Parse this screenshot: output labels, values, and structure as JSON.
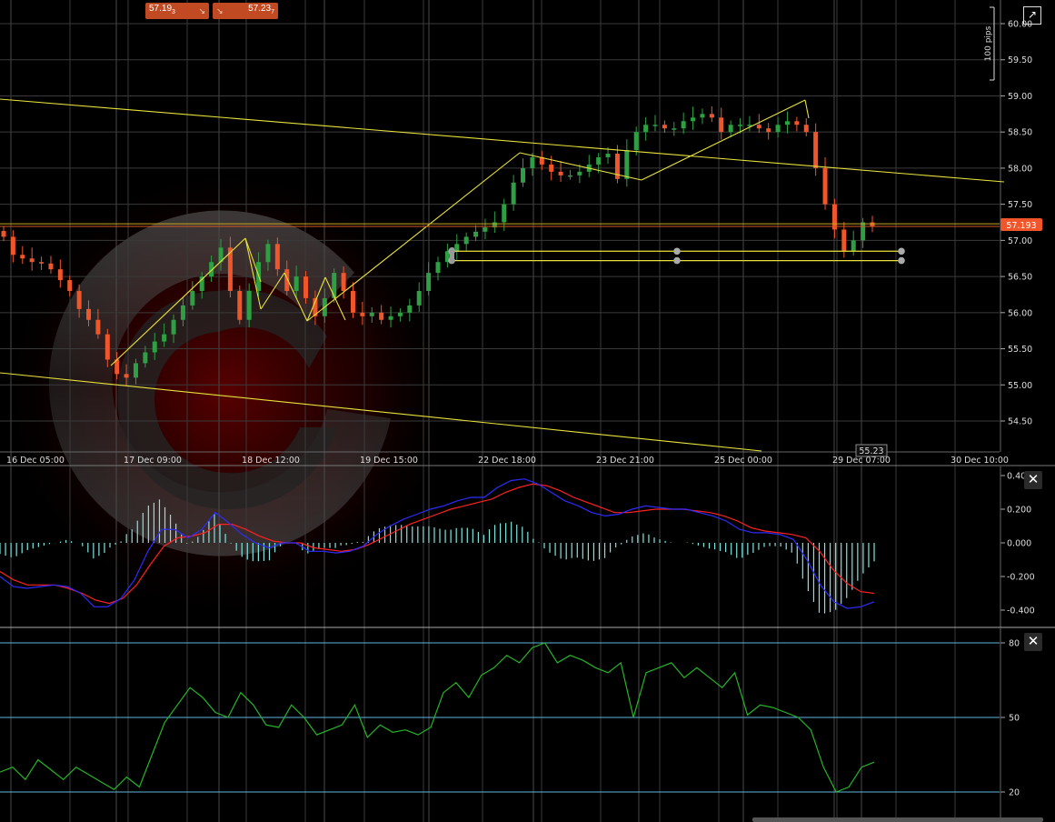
{
  "toolbar": {
    "sell_price": "57.19",
    "sell_price_sup": "3",
    "buy_price": "57.23",
    "buy_price_sup": "7",
    "sell_icon": "arrow-down-right-icon",
    "buy_icon": "arrow-down-right-icon",
    "expand_icon": "expand-icon"
  },
  "colors": {
    "background": "#000000",
    "grid": "#3a3a3a",
    "candle_up": "#2ea043",
    "candle_down": "#f0562a",
    "trendline": "#e8e23a",
    "price_marker": "#f0562a",
    "macd_line": "#2c2cff",
    "signal_line": "#ff2020",
    "histogram": "#7fe6e0",
    "rsi_line": "#25b525",
    "rsi_levels": "#5fb4dc"
  },
  "price_panel": {
    "scale_label": "100 pips",
    "current_price": "57.193",
    "cursor_price": "55.23",
    "y_ticks": [
      "60.00",
      "59.50",
      "59.00",
      "58.50",
      "58.00",
      "57.50",
      "57.00",
      "56.50",
      "56.00",
      "55.50",
      "55.00",
      "54.50"
    ],
    "x_ticks": [
      "16 Dec 05:00",
      "17 Dec 09:00",
      "18 Dec 12:00",
      "19 Dec 15:00",
      "22 Dec 18:00",
      "23 Dec 21:00",
      "25 Dec 00:00",
      "29 Dec 07:00",
      "30 Dec 10:00"
    ]
  },
  "macd_panel": {
    "y_ticks": [
      "0.400",
      "0.200",
      "0.000",
      "-0.200",
      "-0.400"
    ]
  },
  "rsi_panel": {
    "y_ticks": [
      "80",
      "50",
      "20"
    ]
  },
  "chart_data": [
    {
      "type": "candlestick",
      "ylim": [
        54.1,
        60.2
      ],
      "x_ticks": [
        "16 Dec 05:00",
        "17 Dec 09:00",
        "18 Dec 12:00",
        "19 Dec 15:00",
        "22 Dec 18:00",
        "23 Dec 21:00",
        "25 Dec 00:00",
        "29 Dec 07:00",
        "30 Dec 10:00"
      ],
      "closes": [
        57.05,
        56.8,
        56.75,
        56.7,
        56.68,
        56.6,
        56.45,
        56.3,
        56.05,
        55.9,
        55.7,
        55.35,
        55.15,
        55.1,
        55.3,
        55.45,
        55.6,
        55.7,
        55.9,
        56.1,
        56.3,
        56.5,
        56.7,
        56.9,
        56.3,
        55.9,
        56.3,
        56.7,
        56.95,
        56.6,
        56.3,
        56.5,
        56.2,
        55.95,
        56.2,
        56.55,
        56.3,
        56.0,
        55.95,
        56.0,
        55.9,
        55.95,
        56.0,
        56.1,
        56.3,
        56.55,
        56.7,
        56.85,
        56.95,
        57.05,
        57.12,
        57.18,
        57.25,
        57.5,
        57.8,
        58.0,
        58.15,
        58.05,
        57.95,
        57.9,
        57.9,
        57.95,
        58.05,
        58.15,
        58.2,
        57.85,
        58.25,
        58.5,
        58.6,
        58.6,
        58.55,
        58.55,
        58.65,
        58.7,
        58.75,
        58.7,
        58.5,
        58.6,
        58.6,
        58.6,
        58.55,
        58.5,
        58.6,
        58.65,
        58.6,
        58.5,
        58.0,
        57.5,
        57.15,
        56.85,
        57.0,
        57.25,
        57.19
      ],
      "current": 57.193,
      "horizontal_levels": [
        57.23,
        56.85,
        56.72
      ]
    },
    {
      "type": "line",
      "ylim": [
        -0.45,
        0.4
      ],
      "series": [
        {
          "values": [
            -0.2,
            -0.26,
            -0.27,
            -0.26,
            -0.25,
            -0.26,
            -0.3,
            -0.38,
            -0.38,
            -0.33,
            -0.22,
            -0.05,
            0.08,
            0.08,
            0.03,
            0.08,
            0.18,
            0.12,
            0.05,
            0.0,
            -0.03,
            0.0,
            0.0,
            -0.05,
            -0.05,
            -0.06,
            -0.05,
            -0.02,
            0.05,
            0.1,
            0.14,
            0.17,
            0.2,
            0.22,
            0.25,
            0.27,
            0.27,
            0.33,
            0.37,
            0.38,
            0.35,
            0.3,
            0.25,
            0.22,
            0.18,
            0.16,
            0.17,
            0.2,
            0.22,
            0.21,
            0.2,
            0.2,
            0.18,
            0.16,
            0.13,
            0.08,
            0.06,
            0.06,
            0.05,
            0.02,
            -0.1,
            -0.25,
            -0.35,
            -0.39,
            -0.38,
            -0.35
          ]
        },
        {
          "values": [
            -0.17,
            -0.22,
            -0.25,
            -0.25,
            -0.25,
            -0.27,
            -0.3,
            -0.34,
            -0.36,
            -0.33,
            -0.25,
            -0.13,
            -0.02,
            0.03,
            0.04,
            0.06,
            0.11,
            0.11,
            0.08,
            0.04,
            0.01,
            0.0,
            0.0,
            -0.03,
            -0.04,
            -0.05,
            -0.04,
            -0.01,
            0.03,
            0.07,
            0.11,
            0.14,
            0.17,
            0.2,
            0.22,
            0.24,
            0.26,
            0.3,
            0.33,
            0.35,
            0.34,
            0.31,
            0.27,
            0.24,
            0.21,
            0.18,
            0.18,
            0.19,
            0.2,
            0.2,
            0.2,
            0.19,
            0.18,
            0.16,
            0.13,
            0.09,
            0.07,
            0.06,
            0.05,
            0.03,
            -0.05,
            -0.16,
            -0.24,
            -0.29,
            -0.3
          ]
        }
      ]
    },
    {
      "type": "line",
      "ylim": [
        18,
        82
      ],
      "levels": [
        80,
        50,
        20
      ],
      "series": [
        {
          "values": [
            28,
            30,
            25,
            33,
            29,
            25,
            30,
            27,
            24,
            21,
            26,
            22,
            35,
            48,
            55,
            62,
            58,
            52,
            50,
            60,
            55,
            47,
            46,
            55,
            50,
            43,
            45,
            47,
            55,
            42,
            47,
            44,
            45,
            43,
            46,
            60,
            64,
            58,
            67,
            70,
            75,
            72,
            78,
            80,
            72,
            75,
            73,
            70,
            68,
            72,
            50,
            68,
            70,
            72,
            66,
            70,
            66,
            62,
            68,
            51,
            55,
            54,
            52,
            50,
            45,
            30,
            20,
            22,
            30,
            32
          ]
        }
      ]
    }
  ]
}
